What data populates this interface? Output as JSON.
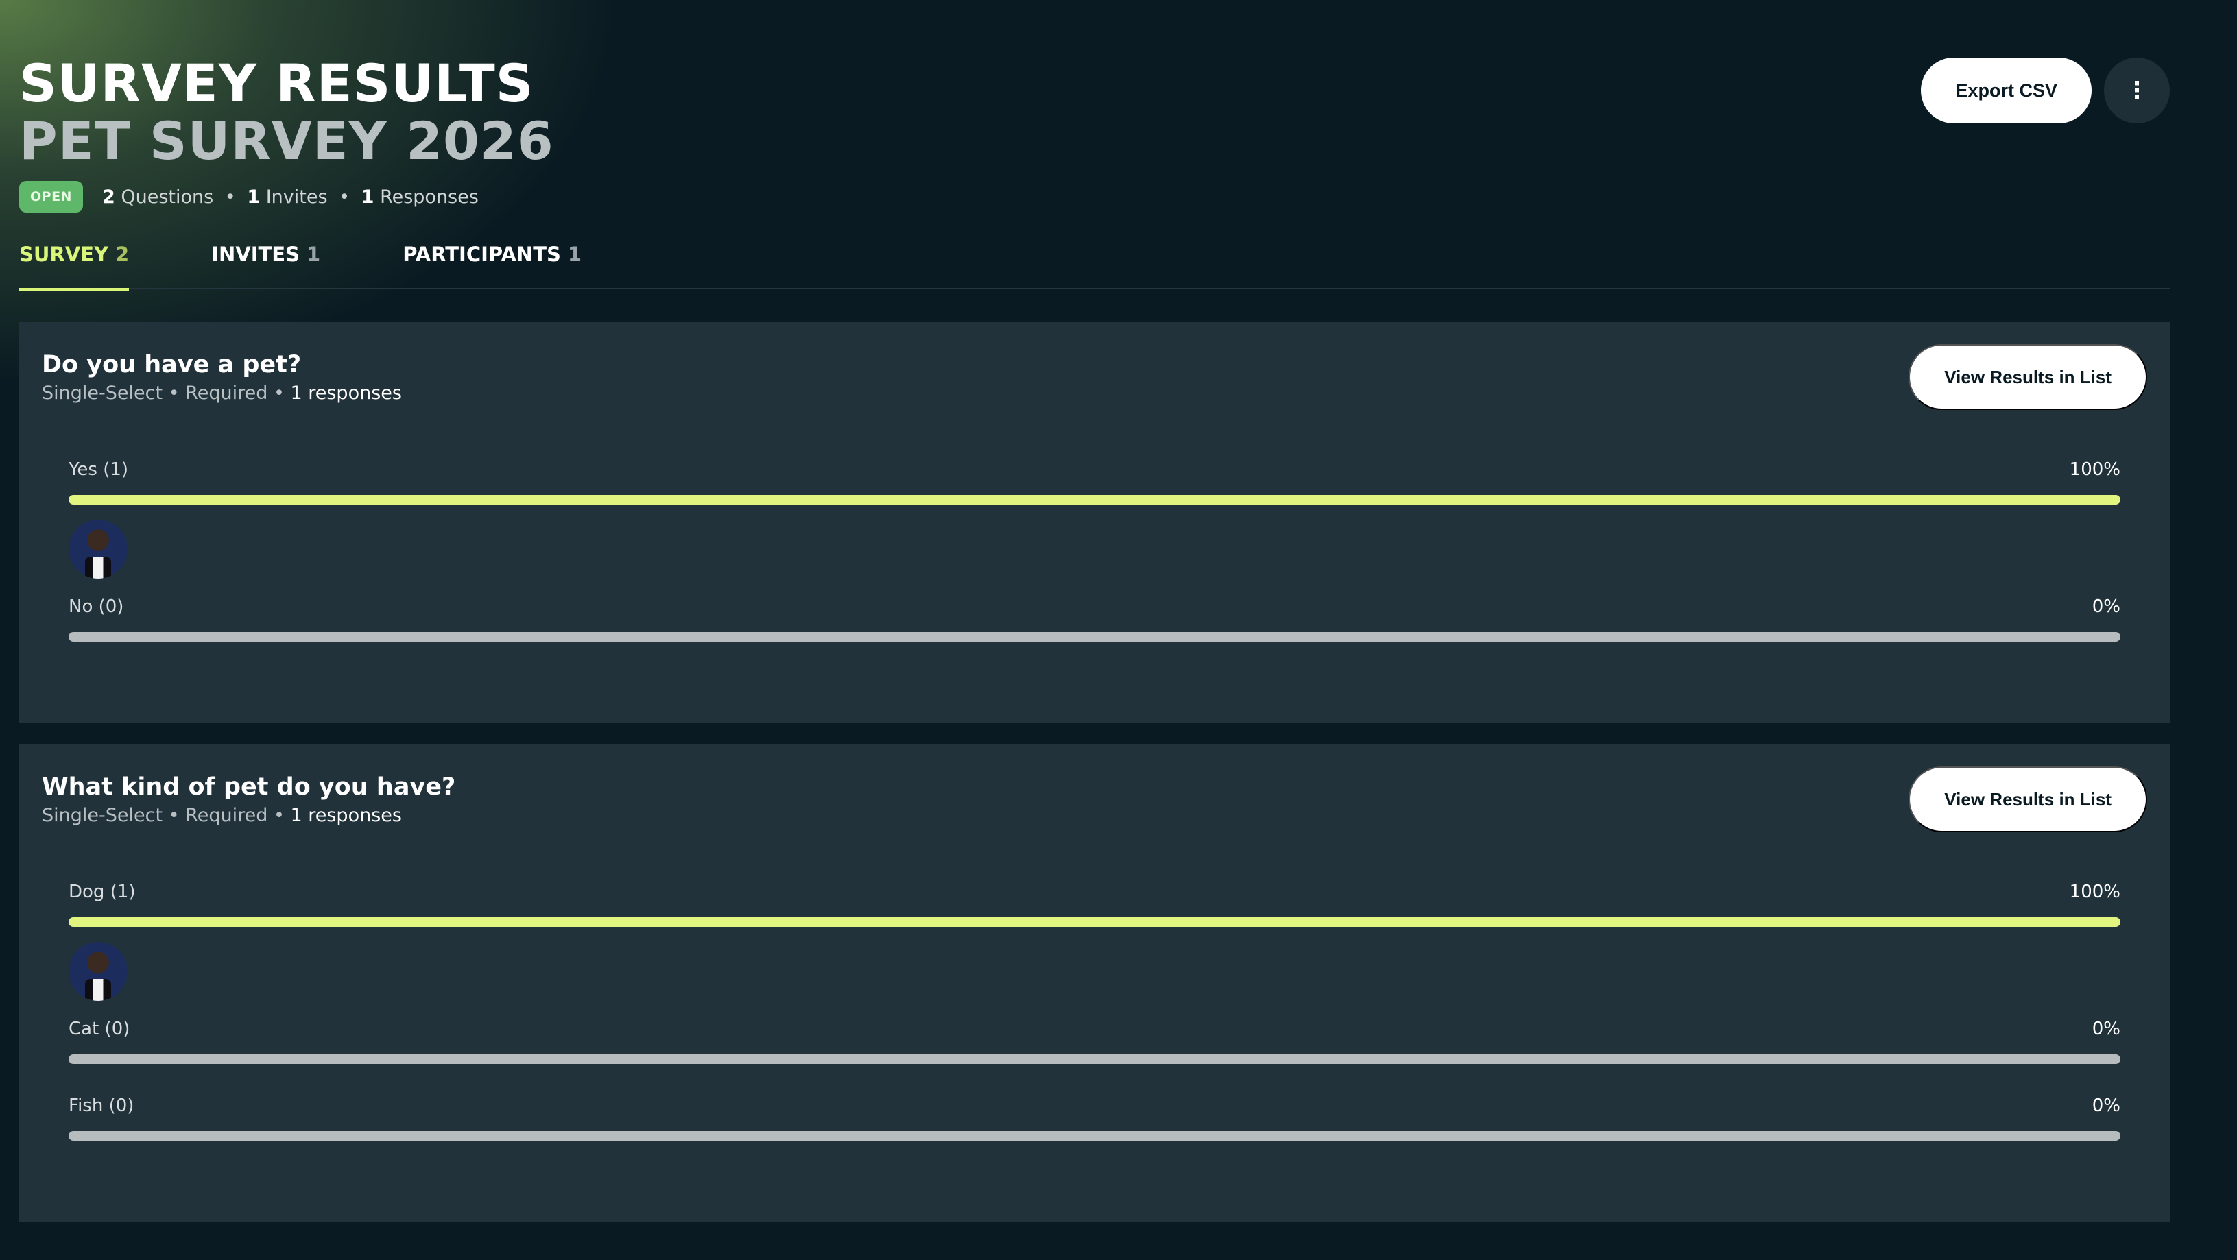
{
  "header": {
    "title": "SURVEY RESULTS",
    "subtitle": "PET SURVEY 2026",
    "status_badge": "OPEN",
    "stats": {
      "questions_count": "2",
      "questions_label": "Questions",
      "invites_count": "1",
      "invites_label": "Invites",
      "responses_count": "1",
      "responses_label": "Responses",
      "separator": "•"
    }
  },
  "actions": {
    "export_label": "Export CSV",
    "more_icon": "⋮"
  },
  "tabs": [
    {
      "label": "SURVEY",
      "count": "2",
      "active": true
    },
    {
      "label": "INVITES",
      "count": "1",
      "active": false
    },
    {
      "label": "PARTICIPANTS",
      "count": "1",
      "active": false
    }
  ],
  "questions": [
    {
      "title": "Do you have a pet?",
      "type": "Single-Select",
      "required": "Required",
      "responses_count": "1",
      "responses_label": "responses",
      "view_button": "View Results in List",
      "options": [
        {
          "label": "Yes (1)",
          "percent": "100%",
          "fraction": 1.0,
          "respondent_avatar": true
        },
        {
          "label": "No (0)",
          "percent": "0%",
          "fraction": 0.0,
          "respondent_avatar": false
        }
      ]
    },
    {
      "title": "What kind of pet do you have?",
      "type": "Single-Select",
      "required": "Required",
      "responses_count": "1",
      "responses_label": "responses",
      "view_button": "View Results in List",
      "options": [
        {
          "label": "Dog (1)",
          "percent": "100%",
          "fraction": 1.0,
          "respondent_avatar": true
        },
        {
          "label": "Cat (0)",
          "percent": "0%",
          "fraction": 0.0,
          "respondent_avatar": false
        },
        {
          "label": "Fish (0)",
          "percent": "0%",
          "fraction": 0.0,
          "respondent_avatar": false
        }
      ]
    }
  ],
  "colors": {
    "accent": "#e1f57f",
    "background": "#0a1a22",
    "card": "#21323b",
    "badge": "#5fb869",
    "bar_empty": "#b7bcbf"
  }
}
